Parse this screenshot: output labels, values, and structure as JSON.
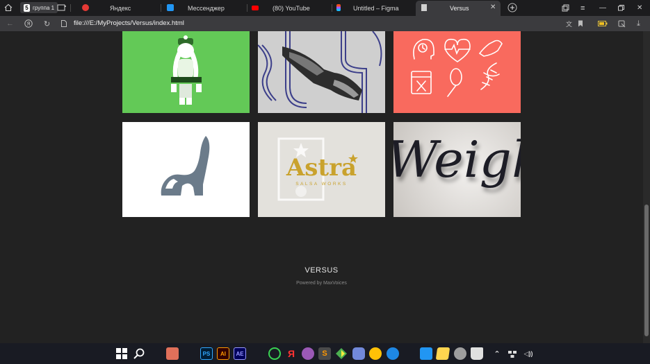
{
  "browser": {
    "group_chip": {
      "number": "5",
      "label": "группа 1"
    },
    "tabs": [
      {
        "label": "Яндекс",
        "favicon": "yandex-icon",
        "color": "#e53935"
      },
      {
        "label": "Мессенджер",
        "favicon": "messenger-icon",
        "color": "#2196f3"
      },
      {
        "label": "(80) YouTube",
        "favicon": "youtube-icon",
        "color": "#ff0000"
      },
      {
        "label": "Untitled – Figma",
        "favicon": "figma-icon",
        "color": "#a259ff"
      },
      {
        "label": "Versus",
        "favicon": "document-icon",
        "color": "#d0d0d0"
      }
    ],
    "address": {
      "url": "file:///E:/MyProjects/Versus/index.html"
    }
  },
  "page": {
    "footer": {
      "title": "VERSUS",
      "subtitle": "Powered by MaxVoices"
    },
    "portfolio": [
      {
        "name": "green-character-card",
        "bg": "#63c957"
      },
      {
        "name": "hands-card",
        "bg": "#cfcfcf"
      },
      {
        "name": "health-icons-card",
        "bg": "#f96a5e"
      },
      {
        "name": "elephant-logo-card",
        "bg": "#ffffff"
      },
      {
        "name": "astra-logo-card",
        "bg": "#e3e1dc",
        "title": "Astra",
        "subtitle": "SALSA WORKS"
      },
      {
        "name": "weight-lettering-card",
        "bg": "#dedad6",
        "title": "Weight"
      }
    ]
  },
  "taskbar": {
    "apps": [
      {
        "name": "start-icon",
        "label": "",
        "color": "#ffffff"
      },
      {
        "name": "search-icon",
        "label": "",
        "color": "#ffffff"
      },
      {
        "name": "window-app-icon",
        "label": "",
        "color": "#e0705a"
      },
      {
        "name": "photoshop-icon",
        "label": "PS",
        "color": "#31a8ff"
      },
      {
        "name": "illustrator-icon",
        "label": "AI",
        "color": "#ff9a00"
      },
      {
        "name": "after-effects-icon",
        "label": "AE",
        "color": "#9999ff"
      },
      {
        "name": "opera-icon",
        "label": "",
        "color": "#39d353"
      },
      {
        "name": "yandex-browser-icon",
        "label": "Я",
        "color": "#ff3333"
      },
      {
        "name": "tor-icon",
        "label": "",
        "color": "#9b59b6"
      },
      {
        "name": "sublime-icon",
        "label": "S",
        "color": "#ff9800"
      },
      {
        "name": "sourcetree-icon",
        "label": "",
        "color": "#4caf50"
      },
      {
        "name": "discord-icon",
        "label": "",
        "color": "#7289da"
      },
      {
        "name": "emoji-app-icon",
        "label": "",
        "color": "#ffc107"
      },
      {
        "name": "steam-icon",
        "label": "",
        "color": "#1e88e5"
      },
      {
        "name": "excel-like-icon",
        "label": "",
        "color": "#2196f3"
      },
      {
        "name": "notepad-icon",
        "label": "",
        "color": "#ffd54f"
      },
      {
        "name": "settings-icon",
        "label": "",
        "color": "#9e9e9e"
      },
      {
        "name": "recycle-bin-icon",
        "label": "",
        "color": "#e0e0e0"
      }
    ]
  }
}
